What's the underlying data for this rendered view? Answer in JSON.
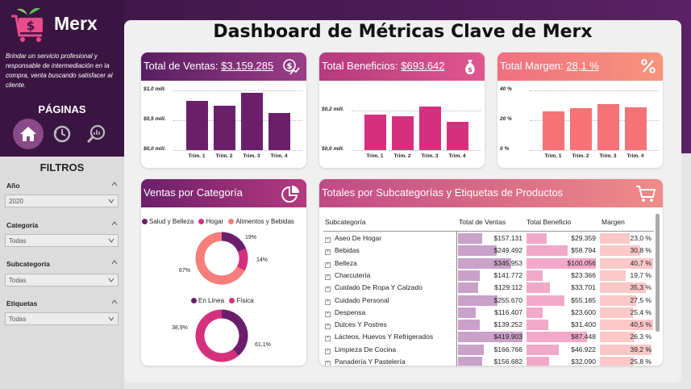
{
  "brand": {
    "name": "Merx",
    "tagline": "Brindar un servicio profesional y responsable de intermediación en la compra, venta buscando satisfacer al cliente."
  },
  "dashboard_title": "Dashboard de Métricas Clave de Merx",
  "nav": {
    "heading": "PÁGINAS",
    "buttons": [
      {
        "icon": "home-icon",
        "active": true
      },
      {
        "icon": "history-icon",
        "active": false
      },
      {
        "icon": "search-chart-icon",
        "active": false
      }
    ]
  },
  "filters": {
    "heading": "FILTROS",
    "items": [
      {
        "label": "Año",
        "value": "2020"
      },
      {
        "label": "Categoría",
        "value": "Todas"
      },
      {
        "label": "Subcategoría",
        "value": "Todas"
      },
      {
        "label": "Etiquetas",
        "value": "Todas"
      }
    ]
  },
  "kpis": [
    {
      "label": "Total de Ventas:",
      "value": "$3.159.285",
      "icon": "money-growth-icon",
      "color_from": "#5a1e62",
      "color_to": "#9a3e86"
    },
    {
      "label": "Total Beneficios:",
      "value": "$693.642",
      "icon": "money-bag-icon",
      "color_from": "#b53a7f",
      "color_to": "#e0578e"
    },
    {
      "label": "Total Margen:",
      "value": "28,1 %",
      "icon": "percent-icon",
      "color_from": "#f07080",
      "color_to": "#f7947c"
    }
  ],
  "chart_data": [
    {
      "type": "bar",
      "categories": [
        "Trim. 1",
        "Trim. 2",
        "Trim. 3",
        "Trim. 4"
      ],
      "values": [
        0.82,
        0.74,
        0.96,
        0.62
      ],
      "ylim": [
        0,
        1.0
      ],
      "yticks": [
        "$1,0 mill.",
        "$0,5 mill.",
        "$0,0 mill."
      ],
      "color": "#6b1f6b",
      "grid": true
    },
    {
      "type": "bar",
      "categories": [
        "Trim. 1",
        "Trim. 2",
        "Trim. 3",
        "Trim. 4"
      ],
      "values": [
        0.18,
        0.17,
        0.22,
        0.14
      ],
      "ylim": [
        0,
        0.3
      ],
      "yticks": [
        "$0,2 mill.",
        "$0,0 mill."
      ],
      "color": "#d5307e",
      "grid": true
    },
    {
      "type": "bar",
      "categories": [
        "Trim. 1",
        "Trim. 2",
        "Trim. 3",
        "Trim. 4"
      ],
      "values": [
        0.26,
        0.28,
        0.31,
        0.285
      ],
      "ylim": [
        0,
        0.4
      ],
      "yticks": [
        "40 %",
        "20 %",
        "0 %"
      ],
      "color": "#f57276",
      "grid": true
    },
    {
      "type": "pie",
      "title": "Ventas por Categoría",
      "labels": [
        "Salud y Belleza",
        "Hogar",
        "Alimentos y Bebidas"
      ],
      "values": [
        19,
        14,
        67
      ],
      "value_labels": [
        "19%",
        "14%",
        "67%"
      ],
      "colors": [
        "#6b1f6b",
        "#d5307e",
        "#f57d7a"
      ]
    },
    {
      "type": "pie",
      "labels": [
        "En Línea",
        "Física"
      ],
      "values": [
        38.9,
        61.1
      ],
      "value_labels": [
        "38,9%",
        "61,1%"
      ],
      "colors": [
        "#6b1f6b",
        "#d5307e"
      ]
    }
  ],
  "category_card": {
    "title": "Ventas por Categoría",
    "icon": "pie-chart-icon"
  },
  "table_card": {
    "title": "Totales por Subcategorías y Etiquetas de Productos",
    "icon": "cart-icon",
    "columns": [
      "Subcategoría",
      "Total de Ventas",
      "Total Beneficio",
      "Margen"
    ],
    "rows": [
      {
        "sub": "Aseo De Hogar",
        "ventas": "$157.131",
        "v": 157131,
        "benef": "$29.359",
        "b": 29359,
        "margen": "23,0 %",
        "m": 23.0
      },
      {
        "sub": "Bebidas",
        "ventas": "$249.492",
        "v": 249492,
        "benef": "$58.794",
        "b": 58794,
        "margen": "30,8 %",
        "m": 30.8
      },
      {
        "sub": "Belleza",
        "ventas": "$345.953",
        "v": 345953,
        "benef": "$100.056",
        "b": 100056,
        "margen": "40,7 %",
        "m": 40.7
      },
      {
        "sub": "Charcutería",
        "ventas": "$141.772",
        "v": 141772,
        "benef": "$23.366",
        "b": 23366,
        "margen": "19,7 %",
        "m": 19.7
      },
      {
        "sub": "Cuidado De Ropa Y Calzado",
        "ventas": "$129.112",
        "v": 129112,
        "benef": "$33.701",
        "b": 33701,
        "margen": "35,3 %",
        "m": 35.3
      },
      {
        "sub": "Cuidado Personal",
        "ventas": "$255.670",
        "v": 255670,
        "benef": "$55.185",
        "b": 55185,
        "margen": "27,5 %",
        "m": 27.5
      },
      {
        "sub": "Despensa",
        "ventas": "$116.407",
        "v": 116407,
        "benef": "$23.600",
        "b": 23600,
        "margen": "25,4 %",
        "m": 25.4
      },
      {
        "sub": "Dulces Y Postres",
        "ventas": "$139.252",
        "v": 139252,
        "benef": "$31.400",
        "b": 31400,
        "margen": "40,5 %",
        "m": 40.5
      },
      {
        "sub": "Lácteos, Huevos Y Refrigerados",
        "ventas": "$419.903",
        "v": 419903,
        "benef": "$87.448",
        "b": 87448,
        "margen": "26,3 %",
        "m": 26.3
      },
      {
        "sub": "Limpieza De Cocina",
        "ventas": "$166.766",
        "v": 166766,
        "benef": "$46.922",
        "b": 46922,
        "margen": "39,2 %",
        "m": 39.2
      },
      {
        "sub": "Panadería Y Pastelería",
        "ventas": "$156.682",
        "v": 156682,
        "benef": "$32.090",
        "b": 32090,
        "margen": "25,8 %",
        "m": 25.8
      }
    ]
  }
}
